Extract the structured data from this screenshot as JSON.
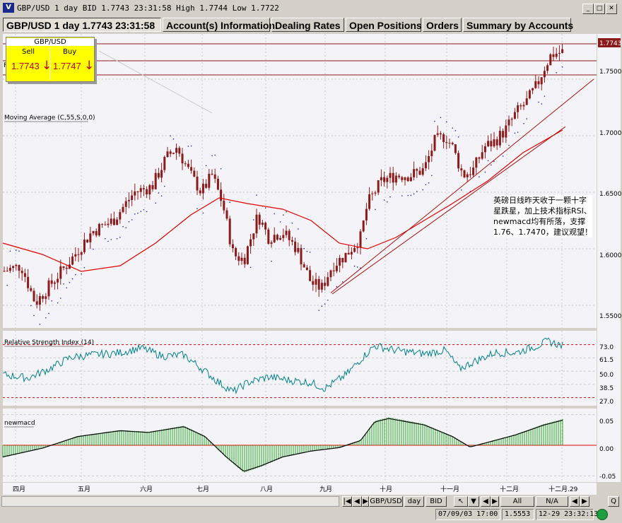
{
  "window": {
    "title": "GBP/USD 1 day BID 1.7743 23:31:58 High 1.7744 Low 1.7722"
  },
  "tabs": [
    {
      "label": "GBP/USD 1 day 1.7743 23:31:58"
    },
    {
      "label": "Account(s) Information"
    },
    {
      "label": "Dealing Rates"
    },
    {
      "label": "Open Positions"
    },
    {
      "label": "Orders"
    },
    {
      "label": "Summary by Accounts"
    }
  ],
  "quote": {
    "title": "GBP/USD",
    "sell_label": "Sell",
    "buy_label": "Buy",
    "sell_value": "1.7743",
    "buy_value": "1.7747",
    "sell_arrow": "↓",
    "buy_arrow": "↓"
  },
  "indicators": {
    "ma_label": "Moving Average (C,55,S,0,0)",
    "rsi_label": "Relative Strength Index (14)",
    "macd_label": "newmacd",
    "f_marker": "F"
  },
  "price_axis": {
    "current": "1.7743",
    "ticks": [
      "1.7500",
      "1.7000",
      "1.6500",
      "1.6000",
      "1.5500"
    ]
  },
  "rsi_axis": {
    "ticks": [
      "73.0",
      "61.5",
      "50.0",
      "38.5",
      "27.0"
    ]
  },
  "macd_axis": {
    "ticks": [
      "0.05",
      "0.00",
      "-0.05"
    ]
  },
  "x_axis": {
    "months": [
      "四月",
      "五月",
      "六月",
      "七月",
      "八月",
      "九月",
      "十月",
      "十一月",
      "十二月",
      "十二月.29"
    ]
  },
  "annotation": "英磅日线昨天收于一颗十字星跌星，加上技术指标RSI、newmacd均有所落，支撑1.76、1.7470，建议观望！",
  "toolbar": {
    "symbol": "GBP/USD",
    "period": "day",
    "side": "BID",
    "all": "All",
    "na": "N/A",
    "q": "Q"
  },
  "status": {
    "datetime": "07/09/03 17:00",
    "value": "1.5553",
    "clock": "12-29 23:32:13"
  },
  "colors": {
    "price_bar": "#8b1a1a",
    "ma": "#e00000",
    "rsi": "#00808a",
    "hist": "#22aa22",
    "macd_line": "#000000",
    "trend": "#a01010"
  },
  "chart_data": [
    {
      "type": "candlestick",
      "title": "GBP/USD 1 day",
      "trend": "uptrend from ~1.56 (Sept) to 1.7743 (Dec 29)",
      "x": [
        "四月",
        "五月",
        "六月",
        "七月",
        "八月",
        "九月",
        "十月",
        "十一月",
        "十二月"
      ],
      "y_ticks": [
        1.55,
        1.6,
        1.65,
        1.7,
        1.75
      ],
      "ylim": [
        1.53,
        1.79
      ],
      "last": 1.7743,
      "high": 1.7744,
      "low": 1.7722,
      "overlays": [
        "Moving Average (C,55,S,0,0)",
        "Parabolic SAR dots",
        "trend lines"
      ]
    },
    {
      "type": "line",
      "title": "Relative Strength Index (14)",
      "y_ticks": [
        27.0,
        38.5,
        50.0,
        61.5,
        73.0
      ],
      "ylim": [
        20,
        85
      ]
    },
    {
      "type": "bar",
      "title": "newmacd",
      "y_ticks": [
        -0.05,
        0.0,
        0.05
      ],
      "ylim": [
        -0.06,
        0.06
      ]
    }
  ]
}
